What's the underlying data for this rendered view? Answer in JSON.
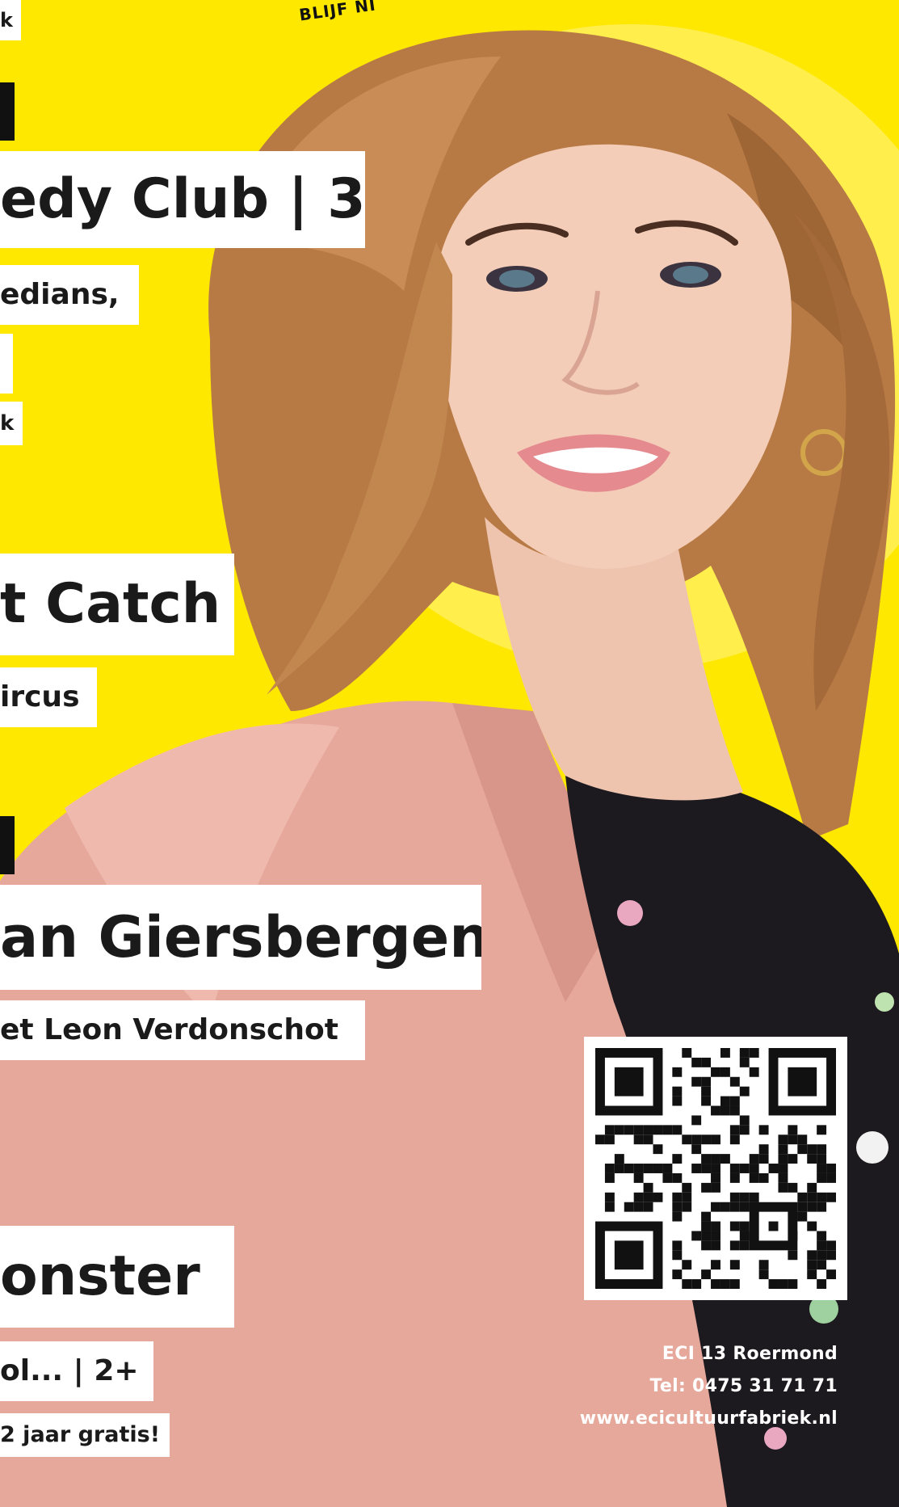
{
  "stamp_text": "BLIJF NI",
  "labels": {
    "top_k": "k",
    "comedy_title": "edy Club | 3",
    "comedy_sub": "edians,",
    "comedy_k": "k",
    "catch_title": "t Catch",
    "catch_sub": "ircus",
    "giersbergen_title": "an Giersbergen",
    "giersbergen_sub": "et Leon Verdonschot",
    "monster_title": "onster",
    "monster_sub": "ol... | 2+",
    "monster_note": "2 jaar gratis!"
  },
  "contact": {
    "address": "ECI 13 Roermond",
    "phone": "Tel: 0475 31 71 71",
    "website": "www.ecicultuurfabriek.nl"
  },
  "colors": {
    "background": "#FFE800",
    "label_bg": "#FFFFFF",
    "label_text": "#1A1A1A",
    "jacket": "#E7A89C",
    "hair": "#B87A45"
  }
}
